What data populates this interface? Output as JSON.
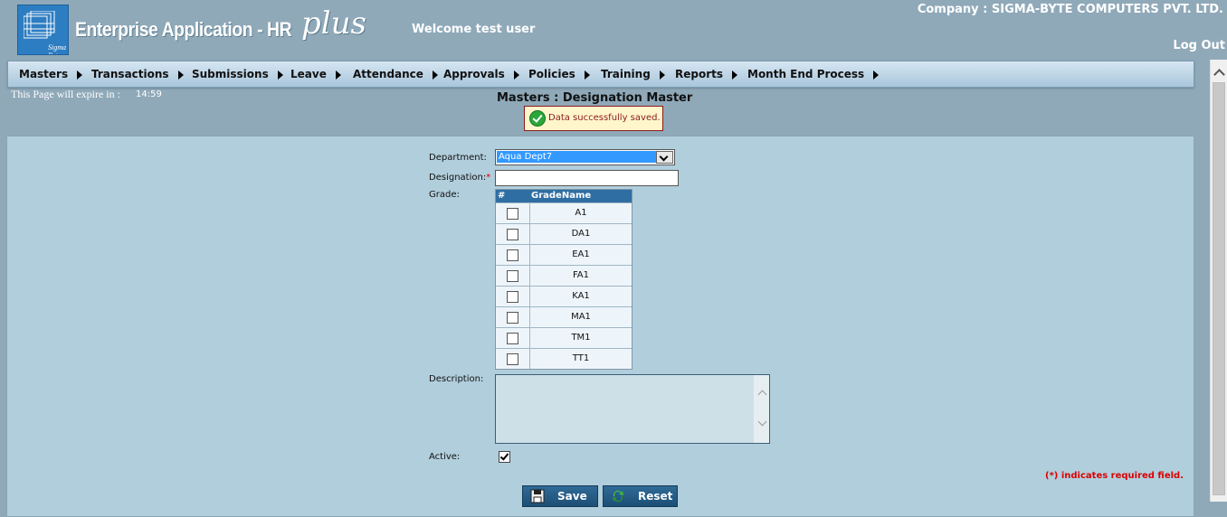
{
  "header": {
    "app_title": "Enterprise Application - HR",
    "app_suffix": "plus",
    "logo_text": "Sigma Byte",
    "welcome": "Welcome test user",
    "company": "Company : SIGMA-BYTE COMPUTERS PVT. LTD.",
    "logout": "Log Out"
  },
  "menu": [
    {
      "label": "Masters"
    },
    {
      "label": "Transactions"
    },
    {
      "label": "Submissions"
    },
    {
      "label": "Leave"
    },
    {
      "label": "Attendance"
    },
    {
      "label": "Approvals"
    },
    {
      "label": "Policies"
    },
    {
      "label": "Training"
    },
    {
      "label": "Reports"
    },
    {
      "label": "Month End Process"
    }
  ],
  "session": {
    "expire_label": "This Page will expire in :",
    "expire_time": "14:59"
  },
  "page": {
    "title": "Masters : Designation Master",
    "message": "Data successfully saved."
  },
  "form": {
    "department_label": "Department:",
    "department_value": "Aqua Dept7",
    "designation_label": "Designation:",
    "required_mark": "*",
    "designation_value": "",
    "grade_label": "Grade:",
    "grade_columns": [
      "#",
      "GradeName"
    ],
    "grades": [
      {
        "name": "A1",
        "checked": false
      },
      {
        "name": "DA1",
        "checked": false
      },
      {
        "name": "EA1",
        "checked": false
      },
      {
        "name": "FA1",
        "checked": false
      },
      {
        "name": "KA1",
        "checked": false
      },
      {
        "name": "MA1",
        "checked": false
      },
      {
        "name": "TM1",
        "checked": false
      },
      {
        "name": "TT1",
        "checked": false
      }
    ],
    "description_label": "Description:",
    "description_value": "",
    "active_label": "Active:",
    "active_checked": true,
    "required_note": "(*) indicates required field.",
    "save_label": "Save",
    "reset_label": "Reset"
  }
}
